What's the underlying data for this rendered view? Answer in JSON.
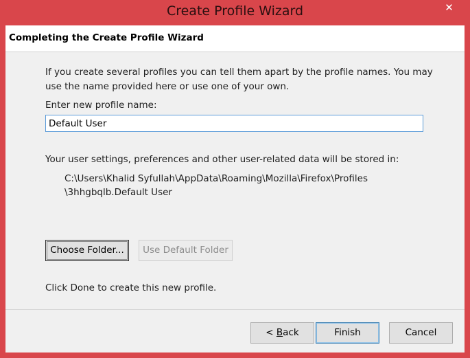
{
  "window": {
    "title": "Create Profile Wizard",
    "close_glyph": "✕"
  },
  "header": {
    "title": "Completing the Create Profile Wizard"
  },
  "content": {
    "intro_line1": "If you create several profiles you can tell them apart by the profile names. You may",
    "intro_line2": "use the name provided here or use one of your own.",
    "name_label": "Enter new profile name:",
    "name_value": "Default User",
    "storage_label": "Your user settings, preferences and other user-related data will be stored in:",
    "path_line1": "C:\\Users\\Khalid Syfullah\\AppData\\Roaming\\Mozilla\\Firefox\\Profiles",
    "path_line2": "\\3hhgbqlb.Default User",
    "done_text": "Click Done to create this new profile."
  },
  "buttons": {
    "choose_folder": "Choose Folder...",
    "use_default_folder": "Use Default Folder",
    "back_lt": "< ",
    "back_key": "B",
    "back_rest": "ack",
    "finish": "Finish",
    "cancel": "Cancel"
  }
}
